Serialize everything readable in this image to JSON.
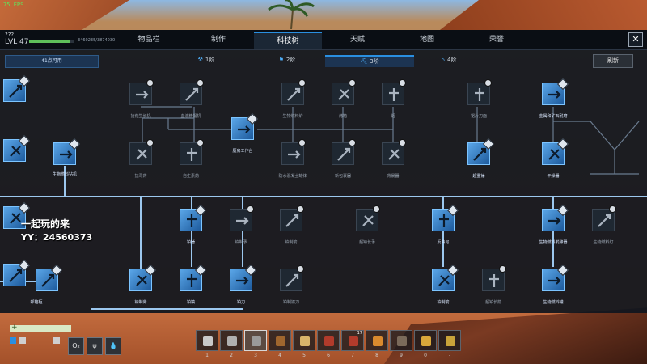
{
  "hud_top": {
    "fps": "75 FPS"
  },
  "player": {
    "name": "???",
    "level": "LVL 47",
    "xp_text": "3460235/3874030",
    "xp_fraction": 0.89
  },
  "tabs": [
    {
      "label": "物品栏",
      "active": false
    },
    {
      "label": "制作",
      "active": false
    },
    {
      "label": "科技树",
      "active": true
    },
    {
      "label": "天赋",
      "active": false
    },
    {
      "label": "地图",
      "active": false
    },
    {
      "label": "荣誉",
      "active": false
    }
  ],
  "close_label": "✕",
  "points_available": "41点可用",
  "tiers": [
    {
      "label": "1阶",
      "icon": "hammer-icon",
      "active": false
    },
    {
      "label": "2阶",
      "icon": "torch-icon",
      "active": false
    },
    {
      "label": "3阶",
      "icon": "workbench-icon",
      "active": true
    },
    {
      "label": "4阶",
      "icon": "building-icon",
      "active": false
    }
  ],
  "refresh_label": "刷新",
  "nodes": [
    {
      "label": "",
      "state": "lit"
    },
    {
      "label": "",
      "state": "lit"
    },
    {
      "label": "",
      "state": "lit"
    },
    {
      "label": "生物燃料钻机",
      "state": "lit"
    },
    {
      "label": "",
      "state": "lit"
    },
    {
      "label": "",
      "state": "lit"
    },
    {
      "label": "",
      "state": "lit"
    },
    {
      "label": "拾荒生长机",
      "state": "dim"
    },
    {
      "label": "血液精馏机",
      "state": "dim"
    },
    {
      "label": "抗毒药",
      "state": "dim"
    },
    {
      "label": "自生素药",
      "state": "dim"
    },
    {
      "label": "厨房工作台",
      "state": "lit"
    },
    {
      "label": "生物燃料炉",
      "state": "dim"
    },
    {
      "label": "烤箱",
      "state": "dim"
    },
    {
      "label": "烟",
      "state": "dim"
    },
    {
      "label": "防水混凝土罐体",
      "state": "dim"
    },
    {
      "label": "新包裹器",
      "state": "dim"
    },
    {
      "label": "背景器",
      "state": "dim"
    },
    {
      "label": "锯片刀面",
      "state": "dim"
    },
    {
      "label": "金属和矿石耐磨",
      "state": "lit"
    },
    {
      "label": "超重锤",
      "state": "lit"
    },
    {
      "label": "干燥器",
      "state": "lit"
    },
    {
      "label": "铂锤",
      "state": "lit"
    },
    {
      "label": "铂制矛",
      "state": "dim"
    },
    {
      "label": "铂制箭",
      "state": "dim"
    },
    {
      "label": "超铂长矛",
      "state": "dim"
    },
    {
      "label": "反曲弓",
      "state": "lit"
    },
    {
      "label": "生物燃料发酵器",
      "state": "lit"
    },
    {
      "label": "生物燃料灯",
      "state": "dim"
    },
    {
      "label": "铂制斧",
      "state": "lit"
    },
    {
      "label": "铂镐",
      "state": "lit"
    },
    {
      "label": "铂刀",
      "state": "lit"
    },
    {
      "label": "铂制镰刀",
      "state": "dim"
    },
    {
      "label": "铂制箭",
      "state": "lit"
    },
    {
      "label": "超铂长箭",
      "state": "dim"
    },
    {
      "label": "生物燃料罐",
      "state": "lit"
    },
    {
      "label": "邮箱柜",
      "state": "lit"
    }
  ],
  "watermark": {
    "line1": "一起玩的来",
    "line2": "YY：24560373"
  },
  "hud": {
    "stats": [
      "O₂",
      "",
      ""
    ],
    "health_fraction": 1.0
  },
  "hotbar": [
    {
      "num": "1",
      "count": "",
      "selected": false
    },
    {
      "num": "2",
      "count": "",
      "selected": false
    },
    {
      "num": "3",
      "count": "",
      "selected": true
    },
    {
      "num": "4",
      "count": "",
      "selected": false
    },
    {
      "num": "5",
      "count": "",
      "selected": false
    },
    {
      "num": "6",
      "count": "",
      "selected": false
    },
    {
      "num": "7",
      "count": "17",
      "selected": false
    },
    {
      "num": "8",
      "count": "",
      "selected": false
    },
    {
      "num": "9",
      "count": "",
      "selected": false
    },
    {
      "num": "0",
      "count": "",
      "selected": false
    },
    {
      "num": "-",
      "count": "",
      "selected": false
    }
  ]
}
